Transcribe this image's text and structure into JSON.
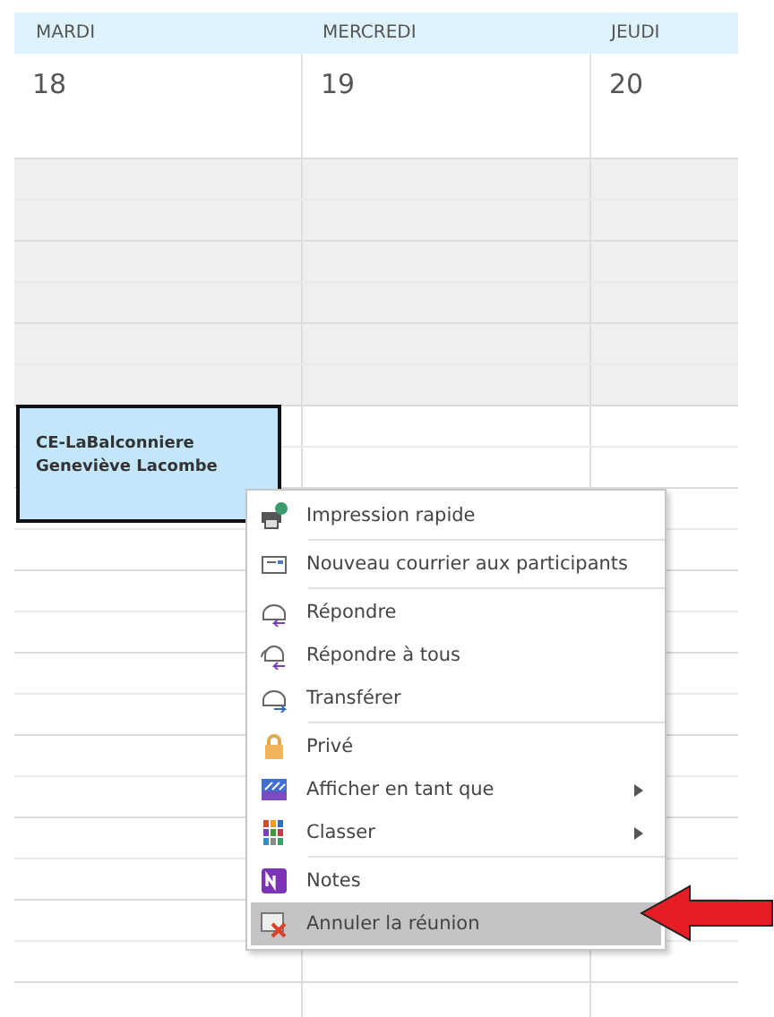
{
  "calendar": {
    "days": [
      {
        "name": "MARDI",
        "date": "18"
      },
      {
        "name": "MERCREDI",
        "date": "19"
      },
      {
        "name": "JEUDI",
        "date": "20"
      }
    ],
    "slots": [
      {
        "working": false
      },
      {
        "working": false
      },
      {
        "working": false
      },
      {
        "working": false
      },
      {
        "working": false
      },
      {
        "working": false
      },
      {
        "working": true
      },
      {
        "working": true
      },
      {
        "working": true
      },
      {
        "working": true
      },
      {
        "working": true
      },
      {
        "working": true
      },
      {
        "working": true
      },
      {
        "working": true
      },
      {
        "working": true
      },
      {
        "working": true
      },
      {
        "working": true
      },
      {
        "working": true
      },
      {
        "working": true
      },
      {
        "working": true
      },
      {
        "working": true
      }
    ],
    "appointment": {
      "title": "CE-LaBalconniere",
      "organizer": "Geneviève Lacombe",
      "selected": true
    }
  },
  "context_menu": {
    "groups": [
      [
        {
          "label": "Impression rapide",
          "submenu": false,
          "selected": false
        }
      ],
      [
        {
          "label": "Nouveau courrier aux participants",
          "submenu": false,
          "selected": false
        }
      ],
      [
        {
          "label": "Répondre",
          "submenu": false,
          "selected": false
        },
        {
          "label": "Répondre à tous",
          "submenu": false,
          "selected": false
        },
        {
          "label": "Transférer",
          "submenu": false,
          "selected": false
        }
      ],
      [
        {
          "label": "Privé",
          "submenu": false,
          "selected": false
        },
        {
          "label": "Afficher en tant que",
          "submenu": true,
          "selected": false
        },
        {
          "label": "Classer",
          "submenu": true,
          "selected": false
        }
      ],
      [
        {
          "label": "Notes",
          "submenu": false,
          "selected": false
        },
        {
          "label": "Annuler la réunion",
          "submenu": false,
          "selected": true
        }
      ]
    ]
  }
}
